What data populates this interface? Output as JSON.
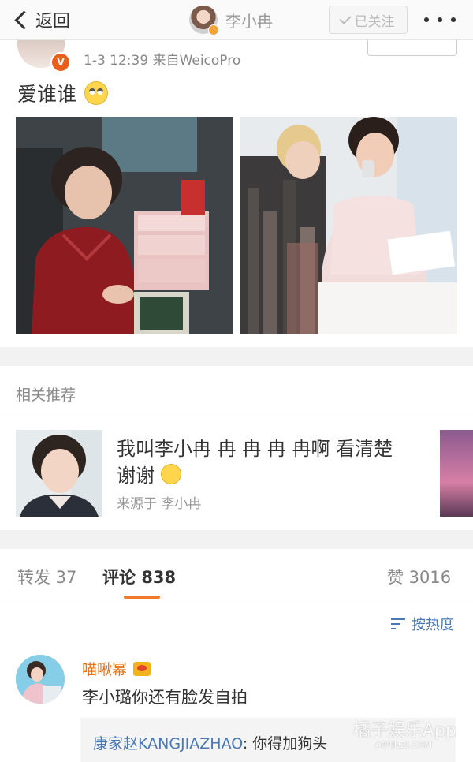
{
  "nav": {
    "back_label": "返回",
    "user_name": "李小冉",
    "follow_label": "已关注"
  },
  "post": {
    "meta": "1-3 12:39  来自WeicoPro",
    "text": "爱谁谁"
  },
  "related": {
    "title": "相关推荐",
    "item_title_part1": "我叫李小冉 冉 冉 冉 冉啊 看清楚 谢谢",
    "item_source": "来源于 李小冉"
  },
  "tabs": {
    "repost": "转发 37",
    "comment_label": "评论",
    "comment_count": "838",
    "like": "赞 3016"
  },
  "sort": {
    "label": "按热度"
  },
  "comment": {
    "user": "喵啾幂",
    "text": "李小璐你还有脸发自拍",
    "reply_user": "康家赵KANGJIAZHAO",
    "reply_text": ": 你得加狗头"
  },
  "watermark": {
    "main": "橘子娱乐App",
    "sub": "APPJUZI.COM"
  },
  "colors": {
    "accent": "#f07a2a",
    "link": "#4a78b4",
    "vip_name": "#e8731a"
  }
}
